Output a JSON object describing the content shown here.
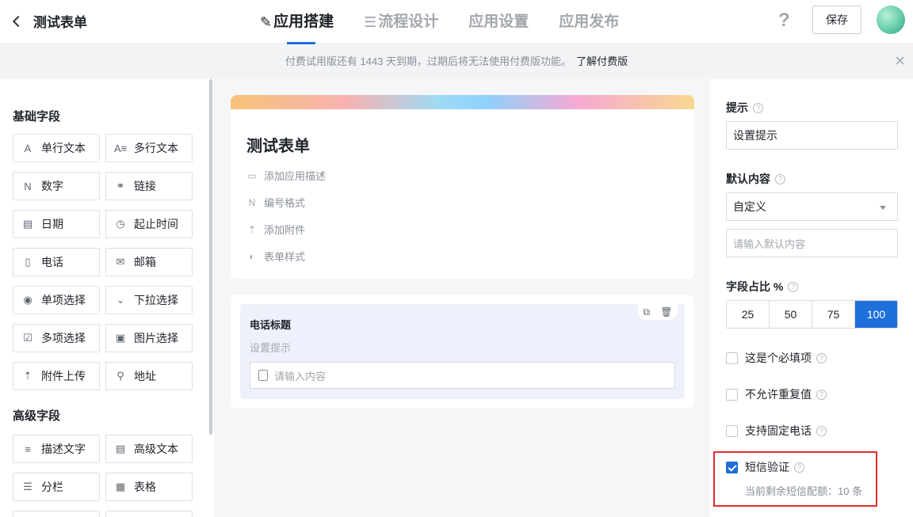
{
  "topbar": {
    "form_title": "测试表单",
    "tabs": [
      {
        "label": "应用搭建",
        "icon": "✎"
      },
      {
        "label": "流程设计",
        "icon": "☰"
      },
      {
        "label": "应用设置",
        "icon": ""
      },
      {
        "label": "应用发布",
        "icon": ""
      }
    ],
    "help": "?",
    "save_label": "保存"
  },
  "notice": {
    "text": "付费试用版还有 1443 天到期，过期后将无法使用付费版功能。",
    "link": "了解付费版",
    "close": "×"
  },
  "left": {
    "basic_title": "基础字段",
    "basic_fields": [
      {
        "label": "单行文本",
        "icon": "A"
      },
      {
        "label": "多行文本",
        "icon": "A≡"
      },
      {
        "label": "数字",
        "icon": "N"
      },
      {
        "label": "链接",
        "icon": "⚭"
      },
      {
        "label": "日期",
        "icon": "▤"
      },
      {
        "label": "起止时间",
        "icon": "◷"
      },
      {
        "label": "电话",
        "icon": "▯"
      },
      {
        "label": "邮箱",
        "icon": "✉"
      },
      {
        "label": "单项选择",
        "icon": "◉"
      },
      {
        "label": "下拉选择",
        "icon": "⌄"
      },
      {
        "label": "多项选择",
        "icon": "☑"
      },
      {
        "label": "图片选择",
        "icon": "▣"
      },
      {
        "label": "附件上传",
        "icon": "⇡"
      },
      {
        "label": "地址",
        "icon": "⚲"
      }
    ],
    "advanced_title": "高级字段",
    "advanced_fields": [
      {
        "label": "描述文字",
        "icon": "≡"
      },
      {
        "label": "高级文本",
        "icon": "▤"
      },
      {
        "label": "分栏",
        "icon": "☰"
      },
      {
        "label": "表格",
        "icon": "▦"
      }
    ]
  },
  "canvas": {
    "form_title": "测试表单",
    "options": [
      {
        "label": "添加应用描述",
        "icon": "▭"
      },
      {
        "label": "编号格式",
        "icon": "N"
      },
      {
        "label": "添加附件",
        "icon": "⇡"
      },
      {
        "label": "表单样式",
        "icon": "◐"
      }
    ],
    "question": {
      "label": "电话标题",
      "hint": "设置提示",
      "placeholder": "请输入内容",
      "copy_icon": "⧉",
      "delete_icon": "🗑"
    }
  },
  "right": {
    "hint_label": "提示",
    "hint_value": "设置提示",
    "default_label": "默认内容",
    "default_select": "自定义",
    "default_placeholder": "请输入默认内容",
    "ratio_label": "字段占比 %",
    "ratio_options": [
      "25",
      "50",
      "75",
      "100"
    ],
    "ratio_selected": "100",
    "checkboxes": [
      {
        "label": "这是个必填项",
        "checked": false
      },
      {
        "label": "不允许重复值",
        "checked": false
      },
      {
        "label": "支持固定电话",
        "checked": false
      },
      {
        "label": "短信验证",
        "checked": true
      }
    ],
    "sms_note": "当前剩余短信配额：10 条"
  },
  "colors": {
    "accent": "#1e6fd9",
    "highlight_box": "#e02e2e"
  }
}
